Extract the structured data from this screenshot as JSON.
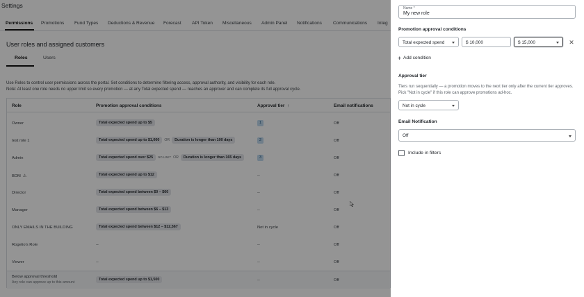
{
  "page": {
    "title": "Settings"
  },
  "tabs": [
    {
      "label": "Permissions"
    },
    {
      "label": "Promotions"
    },
    {
      "label": "Fund Types"
    },
    {
      "label": "Deductions & Revenue"
    },
    {
      "label": "Forecast"
    },
    {
      "label": "API Token"
    },
    {
      "label": "Miscellaneous"
    },
    {
      "label": "Admin Panel"
    },
    {
      "label": "Notifications"
    },
    {
      "label": "Communications"
    },
    {
      "label": "Integ"
    }
  ],
  "section": {
    "title": "User roles and assigned customers"
  },
  "subtabs": [
    {
      "label": "Roles"
    },
    {
      "label": "Users"
    }
  ],
  "intro": {
    "line1": "Use Roles to control user permissions across the portal. Set conditions to determine filtering access, approval authority, and visibility for each role.",
    "line2": "Note: At least one role needs no upper limit so every promotion — at any Total expected spend — reaches an approver and can complete its full approval cycle."
  },
  "table": {
    "headers": {
      "role": "Role",
      "conditions": "Promotion approval conditions",
      "tier": "Approval tier",
      "sort_icon": "arrow-up-icon",
      "email": "Email notifications"
    },
    "rows": [
      {
        "role": "Owner",
        "cond1": "Total expected spend up to $5",
        "or": "",
        "cond2": "",
        "tier": "1",
        "email": "Off"
      },
      {
        "role": "test role 1",
        "cond1": "Total expected spend up to $1,000",
        "or": "OR",
        "cond2": "Duration is longer than 100 days",
        "tier": "2",
        "email": "Off"
      },
      {
        "role": "Admin",
        "cond1": "Total expected spend over $25",
        "nolimit": "NO LIMIT",
        "or": "OR",
        "cond2": "Duration is longer than 165 days",
        "tier": "3",
        "email": "Off"
      },
      {
        "role": "BDM",
        "cond1": "Total expected spend up to $12",
        "or": "",
        "cond2": "",
        "tier": "--",
        "email": "Off",
        "icon": "warning-icon"
      },
      {
        "role": "Director",
        "cond1": "Total expected spend between $0 – $60",
        "or": "",
        "cond2": "",
        "tier": "--",
        "email": "Off"
      },
      {
        "role": "Manager",
        "cond1": "Total expected spend between $6 – $13",
        "or": "",
        "cond2": "",
        "tier": "--",
        "email": "Off"
      },
      {
        "role": "ONLY EMAILS IN THE BUILDING",
        "cond1": "Total expected spend between $12 – $12,567",
        "or": "",
        "cond2": "",
        "tier": "Not in cycle",
        "email": "Off"
      },
      {
        "role": "Rogelio's Role",
        "cond1": "--",
        "or": "",
        "cond2": "",
        "tier": "--",
        "email": "Off"
      },
      {
        "role": "Viewer",
        "cond1": "--",
        "or": "",
        "cond2": "",
        "tier": "--",
        "email": "Off"
      }
    ],
    "footer": {
      "role": "Below approval threshold",
      "sub": "Any role can approve up to this amount",
      "cond": "Total expected spend up to $1,500",
      "tier": "--",
      "email": "Off"
    }
  },
  "drawer": {
    "name": {
      "label": "Name *",
      "value": "My new role"
    },
    "promotion": {
      "title": "Promotion approval conditions",
      "metric": "Total expected spend",
      "min": "$ 10,000",
      "max": "$ 15,000",
      "add_label": "Add condition"
    },
    "tier": {
      "title": "Approval tier",
      "description": "Tiers run sequentially — a promotion moves to the next tier only after the current tier approves. Pick \"Not in cycle\" if this role can approve promotions ad-hoc.",
      "value": "Not in cycle"
    },
    "email": {
      "title": "Email Notification",
      "value": "Off"
    },
    "filters": {
      "label": "Include in filters"
    }
  },
  "colors": {
    "overlay": "#000000",
    "tier_badge": "#bfd9ee",
    "pill": "#e3e6ea"
  }
}
